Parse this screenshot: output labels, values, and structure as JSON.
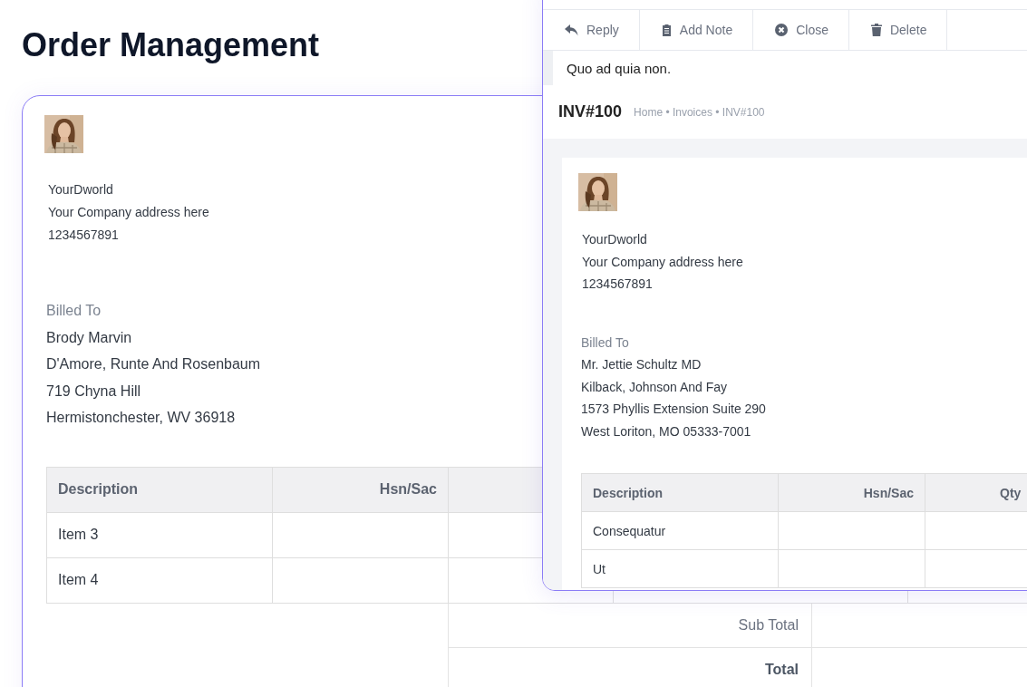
{
  "page_title": "Order Management",
  "invoice_back": {
    "company": {
      "name": "YourDworld",
      "address": "Your Company address here",
      "phone": "1234567891"
    },
    "billed_to": {
      "label": "Billed To",
      "lines": [
        "Brody Marvin",
        "D'Amore, Runte And Rosenbaum",
        "719 Chyna Hill",
        "Hermistonchester, WV 36918"
      ]
    },
    "table": {
      "columns": [
        "Description",
        "Hsn/Sac"
      ],
      "rows": [
        {
          "description": "Item 3"
        },
        {
          "description": "Item 4"
        }
      ]
    },
    "totals": [
      {
        "label": "Sub Total",
        "kind": "subtotal"
      },
      {
        "label": "Total",
        "kind": "total"
      }
    ]
  },
  "invoice_window": {
    "toolbar": [
      {
        "label": "Reply"
      },
      {
        "label": "Add Note"
      },
      {
        "label": "Close"
      },
      {
        "label": "Delete"
      }
    ],
    "note": "Quo ad quia non.",
    "title": "INV#100",
    "breadcrumb": "Home • Invoices • INV#100",
    "invoice": {
      "company": {
        "name": "YourDworld",
        "address": "Your Company address here",
        "phone": "1234567891"
      },
      "billed_to": {
        "label": "Billed To",
        "lines": [
          "Mr. Jettie Schultz MD",
          "Kilback, Johnson And Fay",
          "1573 Phyllis Extension Suite 290",
          "West Loriton, MO 05333-7001"
        ]
      },
      "table": {
        "columns": [
          "Description",
          "Hsn/Sac",
          "Qty"
        ],
        "rows": [
          {
            "description": "Consequatur"
          },
          {
            "description": "Ut"
          }
        ]
      }
    }
  }
}
